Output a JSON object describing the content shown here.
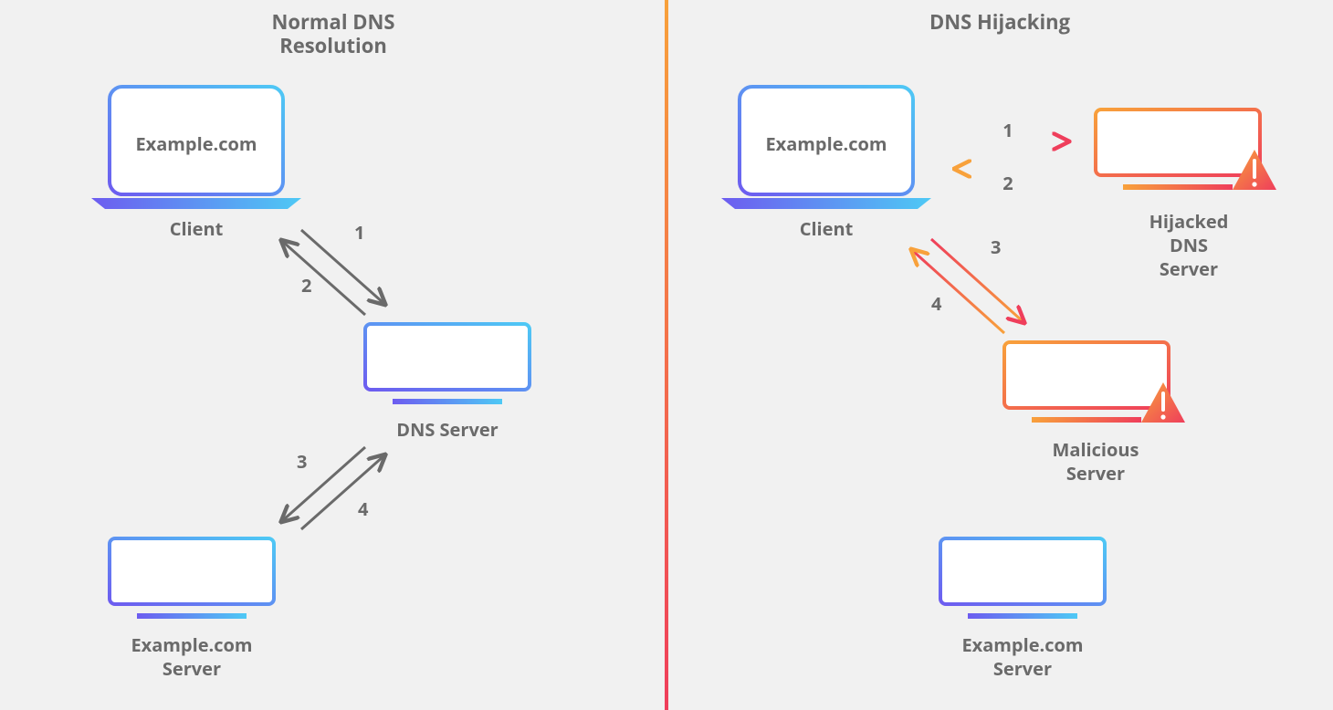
{
  "diagram": {
    "left": {
      "title1": "Normal DNS",
      "title2": "Resolution",
      "client_label": "Client",
      "client_screen": "Example.com",
      "dns_label": "DNS Server",
      "origin_label1": "Example.com",
      "origin_label2": "Server",
      "steps": {
        "s1": "1",
        "s2": "2",
        "s3": "3",
        "s4": "4"
      }
    },
    "right": {
      "title": "DNS Hijacking",
      "client_label": "Client",
      "client_screen": "Example.com",
      "hijacked_label1": "Hijacked",
      "hijacked_label2": "DNS",
      "hijacked_label3": "Server",
      "malicious_label1": "Malicious",
      "malicious_label2": "Server",
      "origin_label1": "Example.com",
      "origin_label2": "Server",
      "steps": {
        "s1": "1",
        "s2": "2",
        "s3": "3",
        "s4": "4"
      }
    }
  },
  "palette": {
    "grey_arrow": "#6a6a6a",
    "blue1": "#6366f1",
    "blue2": "#38bdf8",
    "orange1": "#f59e0b",
    "red1": "#ef4444",
    "pink1": "#f472b6",
    "divider_top": "#f59e0b",
    "divider_bottom": "#ef4444"
  }
}
